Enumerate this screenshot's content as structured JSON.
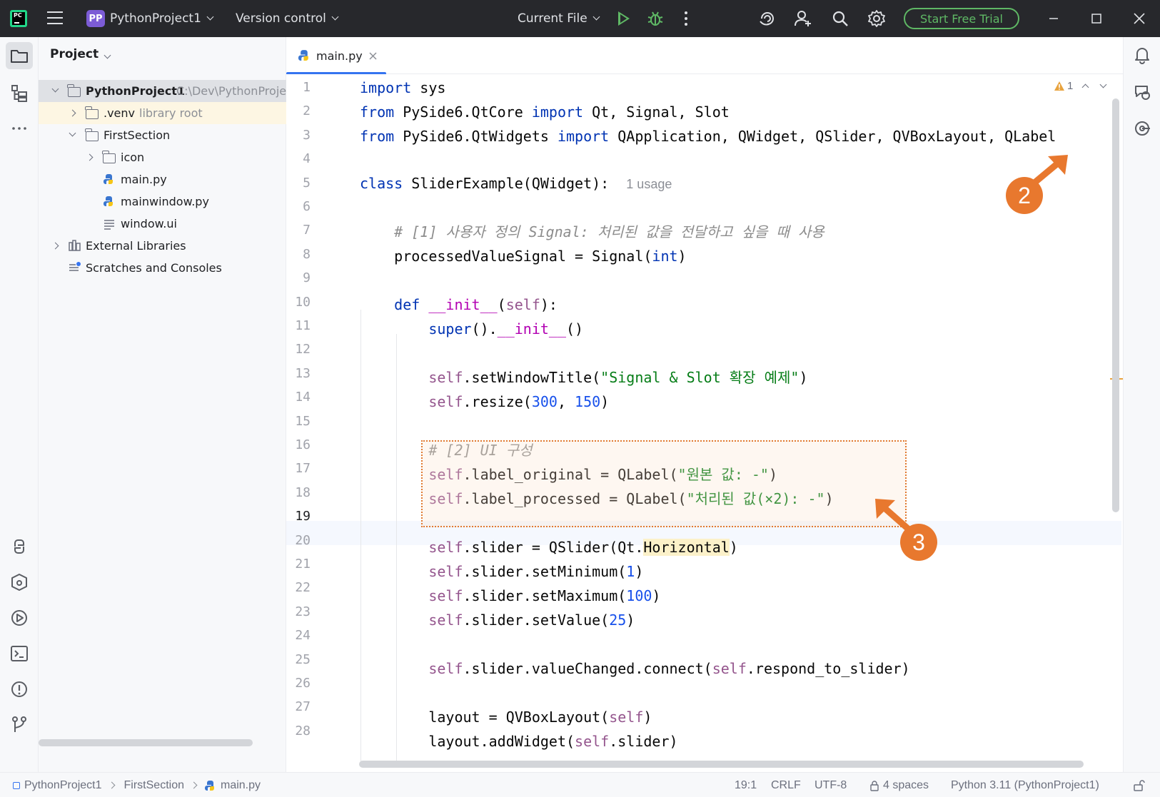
{
  "titlebar": {
    "app_badge": "PP",
    "project_name": "PythonProject1",
    "vcs_label": "Version control",
    "run_config": "Current File",
    "trial_button": "Start Free Trial",
    "logo_text": "PC"
  },
  "project_panel": {
    "title": "Project",
    "tree": [
      {
        "label": "PythonProject1",
        "extra": "C:\\Dev\\PythonProje"
      },
      {
        "label": ".venv",
        "extra": "library root"
      },
      {
        "label": "FirstSection",
        "extra": ""
      },
      {
        "label": "icon",
        "extra": ""
      },
      {
        "label": "main.py",
        "extra": ""
      },
      {
        "label": "mainwindow.py",
        "extra": ""
      },
      {
        "label": "window.ui",
        "extra": ""
      },
      {
        "label": "External Libraries",
        "extra": ""
      },
      {
        "label": "Scratches and Consoles",
        "extra": ""
      }
    ]
  },
  "editor": {
    "tab_label": "main.py",
    "warning_count": "1",
    "usage_hint": "1 usage",
    "line_numbers": [
      "1",
      "2",
      "3",
      "4",
      "5",
      "6",
      "7",
      "8",
      "9",
      "10",
      "11",
      "12",
      "13",
      "14",
      "15",
      "16",
      "17",
      "18",
      "19",
      "20",
      "21",
      "22",
      "23",
      "24",
      "25",
      "26",
      "27",
      "28"
    ],
    "callouts": [
      "2",
      "3"
    ],
    "highlight_color": "#e8782e"
  },
  "statusbar": {
    "crumbs": [
      "PythonProject1",
      "FirstSection",
      "main.py"
    ],
    "position": "19:1",
    "line_ending": "CRLF",
    "encoding": "UTF-8",
    "indent": "4 spaces",
    "interpreter": "Python 3.11 (PythonProject1)"
  }
}
